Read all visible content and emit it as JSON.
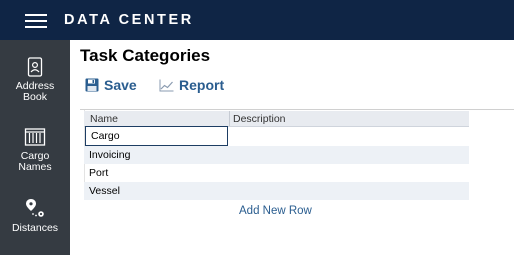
{
  "header": {
    "title": "DATA CENTER",
    "menu_icon": "hamburger-menu-icon"
  },
  "sidebar": {
    "items": [
      {
        "label_line1": "Address",
        "label_line2": "Book",
        "icon": "address-book-icon"
      },
      {
        "label_line1": "Cargo",
        "label_line2": "Names",
        "icon": "cargo-container-icon"
      },
      {
        "label_line1": "Distances",
        "label_line2": "",
        "icon": "route-pins-icon"
      }
    ]
  },
  "page": {
    "title": "Task Categories"
  },
  "toolbar": {
    "save_label": "Save",
    "save_icon": "floppy-disk-icon",
    "report_label": "Report",
    "report_icon": "line-chart-icon"
  },
  "grid": {
    "columns": [
      "Name",
      "Description"
    ],
    "editing_value": "Cargo",
    "rows": [
      {
        "name": "Invoicing",
        "description": ""
      },
      {
        "name": "Port",
        "description": ""
      },
      {
        "name": "Vessel",
        "description": ""
      }
    ],
    "add_row_label": "Add New Row"
  },
  "colors": {
    "topbar": "#0f2545",
    "sidebar": "#353b42",
    "accent": "#2a5d8f",
    "header_row": "#e8ebf0",
    "alt_row": "#edf1f6"
  }
}
